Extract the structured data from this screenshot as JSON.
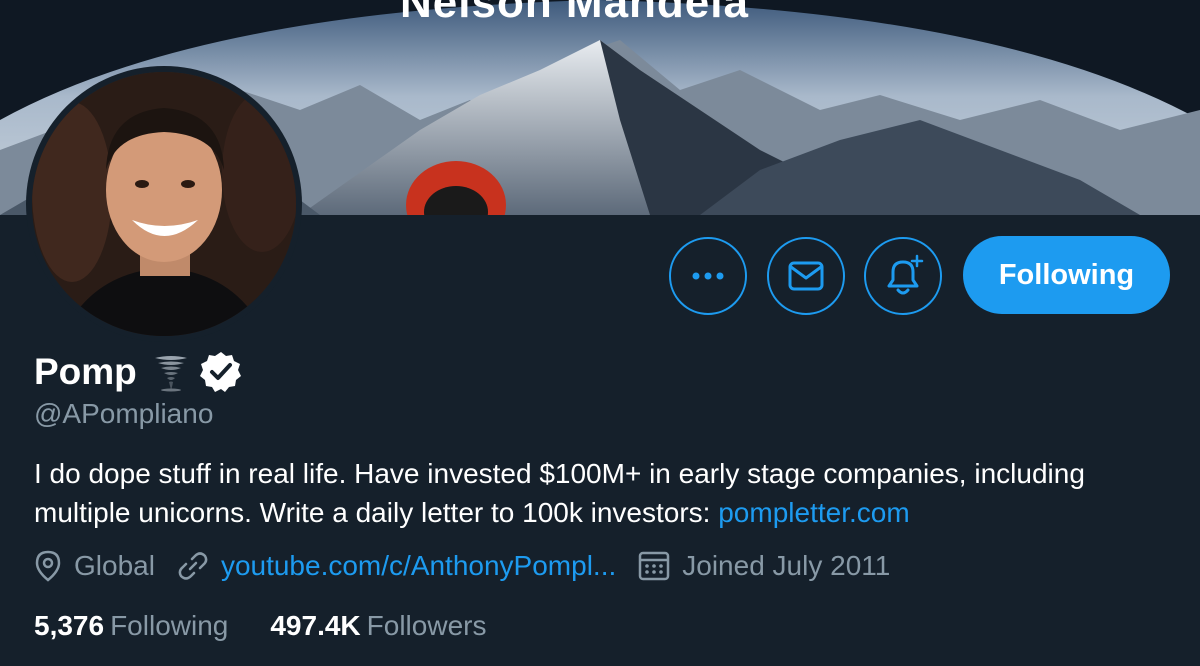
{
  "banner": {
    "caption": "Nelson Mandela"
  },
  "profile": {
    "name": "Pomp",
    "name_emoji": "tornado-icon",
    "verified": true,
    "handle": "@APompliano",
    "bio_text": "I do dope stuff in real life. Have invested $100M+ in early stage companies, including multiple unicorns. Write a daily letter to 100k investors: ",
    "bio_link": "pompletter.com",
    "location": "Global",
    "website": "youtube.com/c/AnthonyPompl...",
    "joined": "Joined July 2011",
    "following_count": "5,376",
    "following_label": "Following",
    "followers_count": "497.4K",
    "followers_label": "Followers"
  },
  "actions": {
    "more_icon": "more-icon",
    "message_icon": "envelope-icon",
    "notify_icon": "bell-plus-icon",
    "follow_button_label": "Following"
  },
  "colors": {
    "background": "#15202b",
    "accent": "#1d9bf0",
    "secondary_text": "#8899a6"
  }
}
